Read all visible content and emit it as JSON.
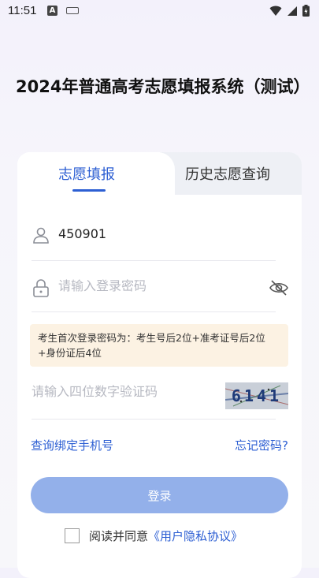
{
  "status_bar": {
    "time": "11:51"
  },
  "header": {
    "title": "2024年普通高考志愿填报系统（测试）"
  },
  "tabs": [
    {
      "label": "志愿填报",
      "active": true
    },
    {
      "label": "历史志愿查询",
      "active": false
    }
  ],
  "form": {
    "username_value": "450901",
    "password_placeholder": "请输入登录密码",
    "notice": "考生首次登录密码为：考生号后2位+准考证号后2位+身份证后4位",
    "captcha_placeholder": "请输入四位数字验证码",
    "captcha_text": "6141"
  },
  "links": {
    "query_phone": "查询绑定手机号",
    "forgot_password": "忘记密码?"
  },
  "login_button": "登录",
  "agreement": {
    "prefix": "阅读并同意",
    "link": "《用户隐私协议》"
  },
  "colors": {
    "accent": "#2d5fd3",
    "button": "#93b0ea",
    "notice_bg": "#fcf2e3"
  }
}
